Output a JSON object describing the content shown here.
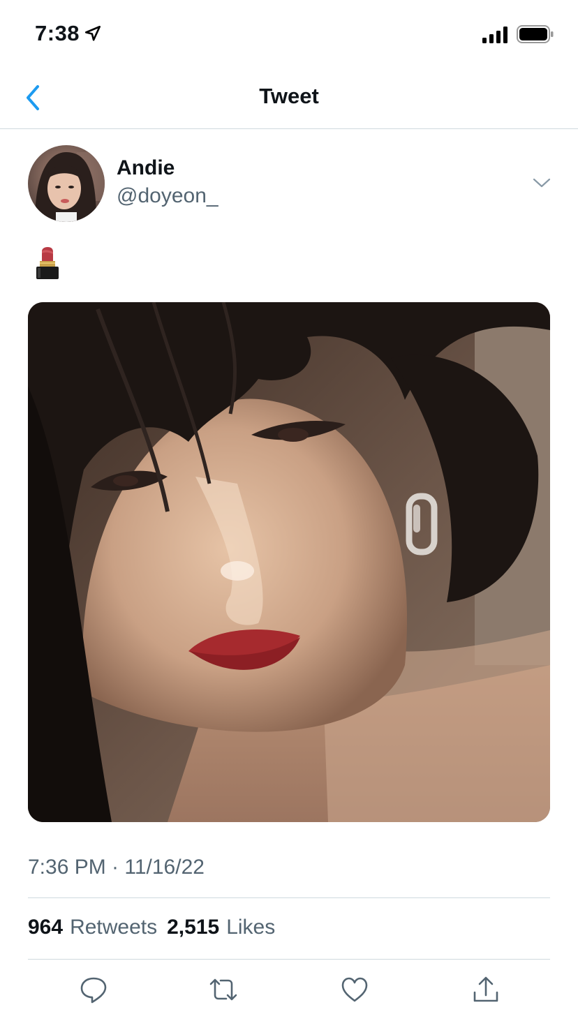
{
  "status_bar": {
    "time": "7:38"
  },
  "nav": {
    "title": "Tweet"
  },
  "tweet": {
    "author": {
      "display_name": "Andie",
      "handle": "@doyeon_"
    },
    "timestamp": "7:36 PM · 11/16/22",
    "stats": {
      "retweets_count": "964",
      "retweets_label": "Retweets",
      "likes_count": "2,515",
      "likes_label": "Likes"
    }
  },
  "colors": {
    "accent": "#1d9bf0",
    "secondary_text": "#536471",
    "divider": "#cfd9de",
    "lipstick": "#b83a44"
  },
  "icons": {
    "back": "chevron-left-icon",
    "more": "chevron-down-icon",
    "reply": "reply-icon",
    "retweet": "retweet-icon",
    "like": "heart-icon",
    "share": "share-icon"
  }
}
